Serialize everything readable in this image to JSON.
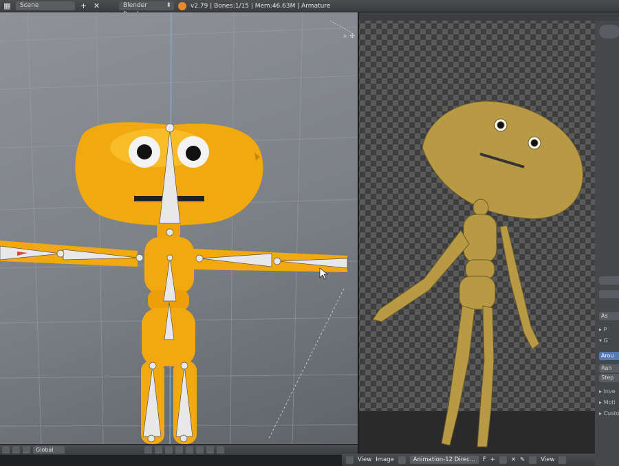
{
  "header": {
    "scene_field": "Scene",
    "render_engine": "Blender Render",
    "stats": "v2.79 | Bones:1/15 | Mem:46.63M | Armature"
  },
  "viewport_header": {
    "orientation": "Global"
  },
  "render_header": {
    "view_menu": "View",
    "image_menu": "Image",
    "image_name": "Animation-12 Direc...",
    "frame_flag": "F",
    "view_menu_2": "View"
  },
  "props_panel": {
    "rows": [
      "As",
      "P",
      "G",
      "Arou",
      "Ran",
      "Step",
      "Inve",
      "Moti",
      "Custo"
    ]
  },
  "colors": {
    "character_yellow": "#f2a90f",
    "bone_white": "#e8e8e8",
    "render_tan": "#b89a45"
  }
}
